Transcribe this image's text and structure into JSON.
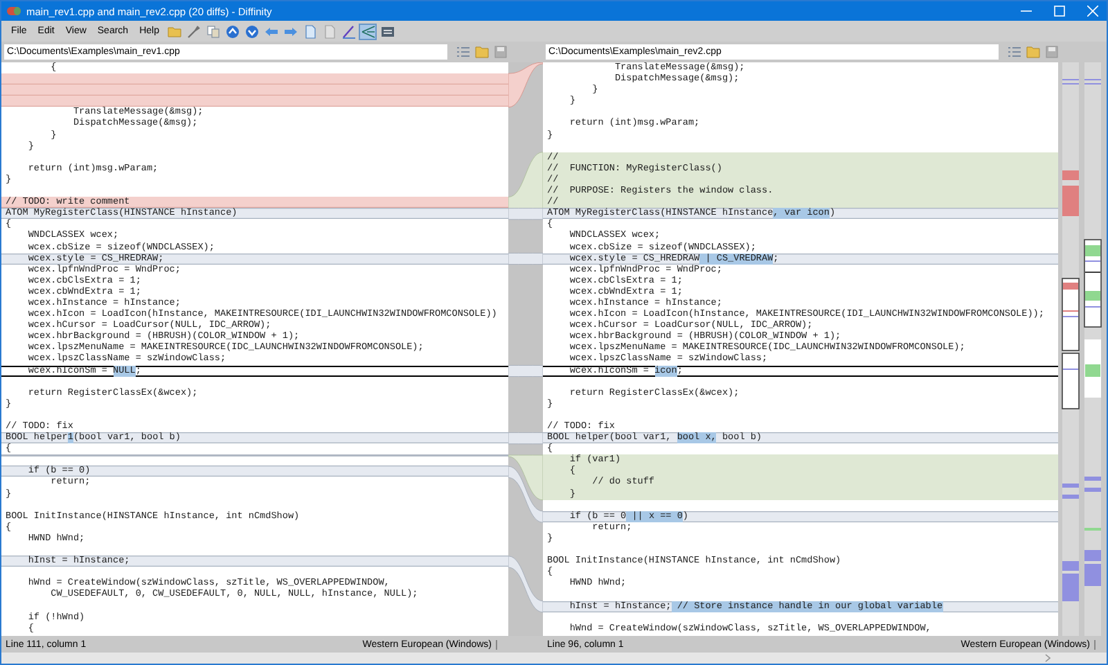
{
  "window": {
    "title": "main_rev1.cpp and main_rev2.cpp (20 diffs) - Diffinity"
  },
  "menu": [
    {
      "label": "File"
    },
    {
      "label": "Edit"
    },
    {
      "label": "View"
    },
    {
      "label": "Search"
    },
    {
      "label": "Help"
    }
  ],
  "toolbar": [
    {
      "kind": "open",
      "selected": false
    },
    {
      "kind": "tools",
      "selected": false
    },
    {
      "kind": "copy",
      "selected": false
    },
    {
      "kind": "up",
      "selected": false
    },
    {
      "kind": "down",
      "selected": false
    },
    {
      "kind": "left",
      "selected": false
    },
    {
      "kind": "right",
      "selected": false
    },
    {
      "kind": "doc",
      "selected": false
    },
    {
      "kind": "doc-grey",
      "selected": false
    },
    {
      "kind": "pen",
      "selected": false
    },
    {
      "kind": "connector",
      "selected": true
    },
    {
      "kind": "whitespace",
      "selected": false
    }
  ],
  "panes": [
    {
      "path": "C:\\Documents\\Examples\\main_rev1.cpp",
      "status": {
        "position": "Line 111, column 1",
        "encoding": "Western European (Windows)"
      },
      "lines": [
        {
          "kind": "normal",
          "text": "        {"
        },
        {
          "kind": "filler-removed"
        },
        {
          "kind": "filler-removed"
        },
        {
          "kind": "filler-removed"
        },
        {
          "kind": "normal",
          "text": "            TranslateMessage(&msg);"
        },
        {
          "kind": "normal",
          "text": "            DispatchMessage(&msg);"
        },
        {
          "kind": "normal",
          "text": "        }"
        },
        {
          "kind": "normal",
          "text": "    }"
        },
        {
          "kind": "blank"
        },
        {
          "kind": "normal",
          "text": "    return (int)msg.wParam;"
        },
        {
          "kind": "normal",
          "text": "}"
        },
        {
          "kind": "blank"
        },
        {
          "kind": "removed",
          "text": "// TODO: write comment"
        },
        {
          "kind": "changed",
          "text": "ATOM MyRegisterClass(HINSTANCE hInstance)"
        },
        {
          "kind": "normal",
          "text": "{"
        },
        {
          "kind": "normal",
          "text": "    WNDCLASSEX wcex;"
        },
        {
          "kind": "normal",
          "text": "    wcex.cbSize = sizeof(WNDCLASSEX);"
        },
        {
          "kind": "changed",
          "text": "    wcex.style = CS_HREDRAW;"
        },
        {
          "kind": "normal",
          "text": "    wcex.lpfnWndProc = WndProc;"
        },
        {
          "kind": "normal",
          "text": "    wcex.cbClsExtra = 1;"
        },
        {
          "kind": "normal",
          "text": "    wcex.cbWndExtra = 1;"
        },
        {
          "kind": "normal",
          "text": "    wcex.hInstance = hInstance;"
        },
        {
          "kind": "normal",
          "text": "    wcex.hIcon = LoadIcon(hInstance, MAKEINTRESOURCE(IDI_LAUNCHWIN32WINDOWFROMCONSOLE))"
        },
        {
          "kind": "normal",
          "text": "    wcex.hCursor = LoadCursor(NULL, IDC_ARROW);"
        },
        {
          "kind": "normal",
          "text": "    wcex.hbrBackground = (HBRUSH)(COLOR_WINDOW + 1);"
        },
        {
          "kind": "normal",
          "text": "    wcex.lpszMenuName = MAKEINTRESOURCE(IDC_LAUNCHWIN32WINDOWFROMCONSOLE);"
        },
        {
          "kind": "normal",
          "text": "    wcex.lpszClassName = szWindowClass;"
        },
        {
          "kind": "current",
          "segments": [
            {
              "text": "    wcex.hIconSm = ",
              "highlight": false
            },
            {
              "text": "NULL",
              "highlight": true
            },
            {
              "text": ";",
              "highlight": false
            }
          ]
        },
        {
          "kind": "blank"
        },
        {
          "kind": "normal",
          "text": "    return RegisterClassEx(&wcex);"
        },
        {
          "kind": "normal",
          "text": "}"
        },
        {
          "kind": "blank"
        },
        {
          "kind": "normal",
          "text": "// TODO: fix"
        },
        {
          "kind": "changed",
          "segments": [
            {
              "text": "BOOL helper",
              "highlight": false
            },
            {
              "text": "1",
              "highlight": true
            },
            {
              "text": "(bool var1, bool b)",
              "highlight": false
            }
          ]
        },
        {
          "kind": "normal",
          "text": "{"
        },
        {
          "kind": "filler"
        },
        {
          "kind": "changed",
          "text": "    if (b == 0)"
        },
        {
          "kind": "normal",
          "text": "        return;"
        },
        {
          "kind": "normal",
          "text": "}"
        },
        {
          "kind": "blank"
        },
        {
          "kind": "normal",
          "text": "BOOL InitInstance(HINSTANCE hInstance, int nCmdShow)"
        },
        {
          "kind": "normal",
          "text": "{"
        },
        {
          "kind": "normal",
          "text": "    HWND hWnd;"
        },
        {
          "kind": "blank"
        },
        {
          "kind": "changed",
          "text": "    hInst = hInstance;"
        },
        {
          "kind": "blank"
        },
        {
          "kind": "normal",
          "text": "    hWnd = CreateWindow(szWindowClass, szTitle, WS_OVERLAPPEDWINDOW,"
        },
        {
          "kind": "normal",
          "text": "        CW_USEDEFAULT, 0, CW_USEDEFAULT, 0, NULL, NULL, hInstance, NULL);"
        },
        {
          "kind": "blank"
        },
        {
          "kind": "normal",
          "text": "    if (!hWnd)"
        },
        {
          "kind": "normal",
          "text": "    {"
        }
      ]
    },
    {
      "path": "C:\\Documents\\Examples\\main_rev2.cpp",
      "status": {
        "position": "Line 96, column 1",
        "encoding": "Western European (Windows)"
      },
      "lines": [
        {
          "kind": "normal",
          "text": "            TranslateMessage(&msg);"
        },
        {
          "kind": "normal",
          "text": "            DispatchMessage(&msg);"
        },
        {
          "kind": "normal",
          "text": "        }"
        },
        {
          "kind": "normal",
          "text": "    }"
        },
        {
          "kind": "blank"
        },
        {
          "kind": "normal",
          "text": "    return (int)msg.wParam;"
        },
        {
          "kind": "normal",
          "text": "}"
        },
        {
          "kind": "blank"
        },
        {
          "kind": "added",
          "text": "//"
        },
        {
          "kind": "added",
          "text": "//  FUNCTION: MyRegisterClass()"
        },
        {
          "kind": "added",
          "text": "//"
        },
        {
          "kind": "added",
          "text": "//  PURPOSE: Registers the window class."
        },
        {
          "kind": "added",
          "text": "//"
        },
        {
          "kind": "changed",
          "segments": [
            {
              "text": "ATOM MyRegisterClass(HINSTANCE hInstance",
              "highlight": false
            },
            {
              "text": ", var icon",
              "highlight": true
            },
            {
              "text": ")",
              "highlight": false
            }
          ]
        },
        {
          "kind": "normal",
          "text": "{"
        },
        {
          "kind": "normal",
          "text": "    WNDCLASSEX wcex;"
        },
        {
          "kind": "normal",
          "text": "    wcex.cbSize = sizeof(WNDCLASSEX);"
        },
        {
          "kind": "changed",
          "segments": [
            {
              "text": "    wcex.style = CS_HREDRAW",
              "highlight": false
            },
            {
              "text": " | CS_VREDRAW",
              "highlight": true
            },
            {
              "text": ";",
              "highlight": false
            }
          ]
        },
        {
          "kind": "normal",
          "text": "    wcex.lpfnWndProc = WndProc;"
        },
        {
          "kind": "normal",
          "text": "    wcex.cbClsExtra = 1;"
        },
        {
          "kind": "normal",
          "text": "    wcex.cbWndExtra = 1;"
        },
        {
          "kind": "normal",
          "text": "    wcex.hInstance = hInstance;"
        },
        {
          "kind": "normal",
          "text": "    wcex.hIcon = LoadIcon(hInstance, MAKEINTRESOURCE(IDI_LAUNCHWIN32WINDOWFROMCONSOLE));"
        },
        {
          "kind": "normal",
          "text": "    wcex.hCursor = LoadCursor(NULL, IDC_ARROW);"
        },
        {
          "kind": "normal",
          "text": "    wcex.hbrBackground = (HBRUSH)(COLOR_WINDOW + 1);"
        },
        {
          "kind": "normal",
          "text": "    wcex.lpszMenuName = MAKEINTRESOURCE(IDC_LAUNCHWIN32WINDOWFROMCONSOLE);"
        },
        {
          "kind": "normal",
          "text": "    wcex.lpszClassName = szWindowClass;"
        },
        {
          "kind": "current",
          "segments": [
            {
              "text": "    wcex.hIconSm = ",
              "highlight": false
            },
            {
              "text": "icon",
              "highlight": true
            },
            {
              "text": ";",
              "highlight": false
            }
          ]
        },
        {
          "kind": "blank"
        },
        {
          "kind": "normal",
          "text": "    return RegisterClassEx(&wcex);"
        },
        {
          "kind": "normal",
          "text": "}"
        },
        {
          "kind": "blank"
        },
        {
          "kind": "normal",
          "text": "// TODO: fix"
        },
        {
          "kind": "changed",
          "segments": [
            {
              "text": "BOOL helper(bool var1, ",
              "highlight": false
            },
            {
              "text": "bool x,",
              "highlight": true
            },
            {
              "text": " bool b)",
              "highlight": false
            }
          ]
        },
        {
          "kind": "normal",
          "text": "{"
        },
        {
          "kind": "added",
          "text": "    if (var1)"
        },
        {
          "kind": "added",
          "text": "    {"
        },
        {
          "kind": "added",
          "text": "        // do stuff"
        },
        {
          "kind": "added",
          "text": "    }"
        },
        {
          "kind": "blank"
        },
        {
          "kind": "changed",
          "segments": [
            {
              "text": "    if (b == 0",
              "highlight": false
            },
            {
              "text": " || x == 0",
              "highlight": true
            },
            {
              "text": ")",
              "highlight": false
            }
          ]
        },
        {
          "kind": "normal",
          "text": "        return;"
        },
        {
          "kind": "normal",
          "text": "}"
        },
        {
          "kind": "blank"
        },
        {
          "kind": "normal",
          "text": "BOOL InitInstance(HINSTANCE hInstance, int nCmdShow)"
        },
        {
          "kind": "normal",
          "text": "{"
        },
        {
          "kind": "normal",
          "text": "    HWND hWnd;"
        },
        {
          "kind": "blank"
        },
        {
          "kind": "changed",
          "segments": [
            {
              "text": "    hInst = hInstance;",
              "highlight": false
            },
            {
              "text": " // Store instance handle in our global variable",
              "highlight": true
            }
          ]
        },
        {
          "kind": "blank"
        },
        {
          "kind": "normal",
          "text": "    hWnd = CreateWindow(szWindowClass, szTitle, WS_OVERLAPPEDWINDOW,"
        }
      ]
    }
  ]
}
